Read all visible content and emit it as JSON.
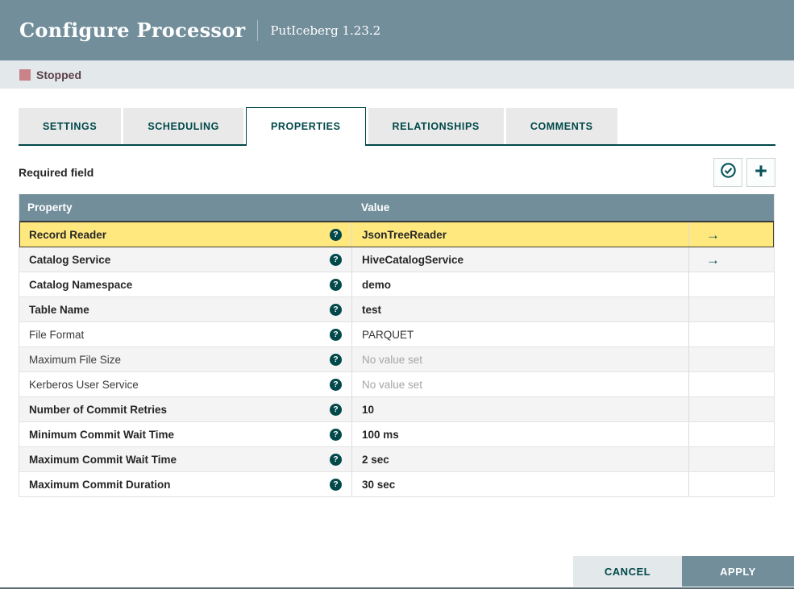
{
  "dialog": {
    "title": "Configure Processor",
    "subtitle": "PutIceberg 1.23.2"
  },
  "status": {
    "label": "Stopped"
  },
  "tabs": [
    {
      "label": "SETTINGS",
      "active": false
    },
    {
      "label": "SCHEDULING",
      "active": false
    },
    {
      "label": "PROPERTIES",
      "active": true
    },
    {
      "label": "RELATIONSHIPS",
      "active": false
    },
    {
      "label": "COMMENTS",
      "active": false
    }
  ],
  "properties_panel": {
    "required_note": "Required field",
    "toolbar": [
      {
        "name": "verify-properties-button",
        "icon": "check-circle-icon"
      },
      {
        "name": "add-property-button",
        "icon": "plus-icon"
      }
    ]
  },
  "icons": {
    "help_glyph": "?",
    "goto_glyph": "→",
    "plus_glyph": "+"
  },
  "table": {
    "columns": {
      "property": "Property",
      "value": "Value"
    },
    "rows": [
      {
        "property": "Record Reader",
        "value": "JsonTreeReader",
        "bold": true,
        "selected": true,
        "empty": false,
        "goto": true
      },
      {
        "property": "Catalog Service",
        "value": "HiveCatalogService",
        "bold": true,
        "selected": false,
        "empty": false,
        "goto": true
      },
      {
        "property": "Catalog Namespace",
        "value": "demo",
        "bold": true,
        "selected": false,
        "empty": false,
        "goto": false
      },
      {
        "property": "Table Name",
        "value": "test",
        "bold": true,
        "selected": false,
        "empty": false,
        "goto": false
      },
      {
        "property": "File Format",
        "value": "PARQUET",
        "bold": false,
        "selected": false,
        "empty": false,
        "goto": false
      },
      {
        "property": "Maximum File Size",
        "value": "No value set",
        "bold": false,
        "selected": false,
        "empty": true,
        "goto": false
      },
      {
        "property": "Kerberos User Service",
        "value": "No value set",
        "bold": false,
        "selected": false,
        "empty": true,
        "goto": false
      },
      {
        "property": "Number of Commit Retries",
        "value": "10",
        "bold": true,
        "selected": false,
        "empty": false,
        "goto": false
      },
      {
        "property": "Minimum Commit Wait Time",
        "value": "100 ms",
        "bold": true,
        "selected": false,
        "empty": false,
        "goto": false
      },
      {
        "property": "Maximum Commit Wait Time",
        "value": "2 sec",
        "bold": true,
        "selected": false,
        "empty": false,
        "goto": false
      },
      {
        "property": "Maximum Commit Duration",
        "value": "30 sec",
        "bold": true,
        "selected": false,
        "empty": false,
        "goto": false
      }
    ]
  },
  "footer": {
    "cancel_label": "CANCEL",
    "apply_label": "APPLY"
  },
  "colors": {
    "header_bg": "#728e9b",
    "accent_teal": "#004849",
    "selected_row": "#ffe97f",
    "stopped_red": "#c9818a",
    "status_bar_bg": "#e3e8eb"
  }
}
